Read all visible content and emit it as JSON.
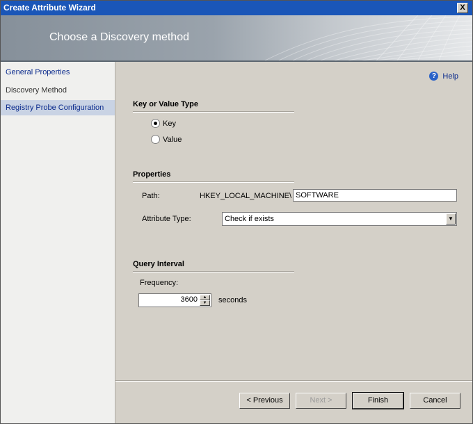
{
  "window": {
    "title": "Create Attribute Wizard",
    "close_label": "X"
  },
  "banner": {
    "heading": "Choose a Discovery method"
  },
  "sidebar": {
    "items": [
      {
        "label": "General Properties"
      },
      {
        "label": "Discovery Method"
      },
      {
        "label": "Registry Probe Configuration"
      }
    ]
  },
  "help": {
    "label": "Help",
    "icon": "question-icon"
  },
  "key_value": {
    "title": "Key or Value Type",
    "options": [
      {
        "label": "Key",
        "checked": true
      },
      {
        "label": "Value",
        "checked": false
      }
    ]
  },
  "properties": {
    "title": "Properties",
    "path_label": "Path:",
    "path_prefix": "HKEY_LOCAL_MACHINE\\",
    "path_value": "SOFTWARE",
    "attribute_type_label": "Attribute Type:",
    "attribute_type_value": "Check if exists"
  },
  "query": {
    "title": "Query Interval",
    "frequency_label": "Frequency:",
    "frequency_value": "3600",
    "unit": "seconds"
  },
  "buttons": {
    "previous": "< Previous",
    "next": "Next >",
    "finish": "Finish",
    "cancel": "Cancel"
  }
}
